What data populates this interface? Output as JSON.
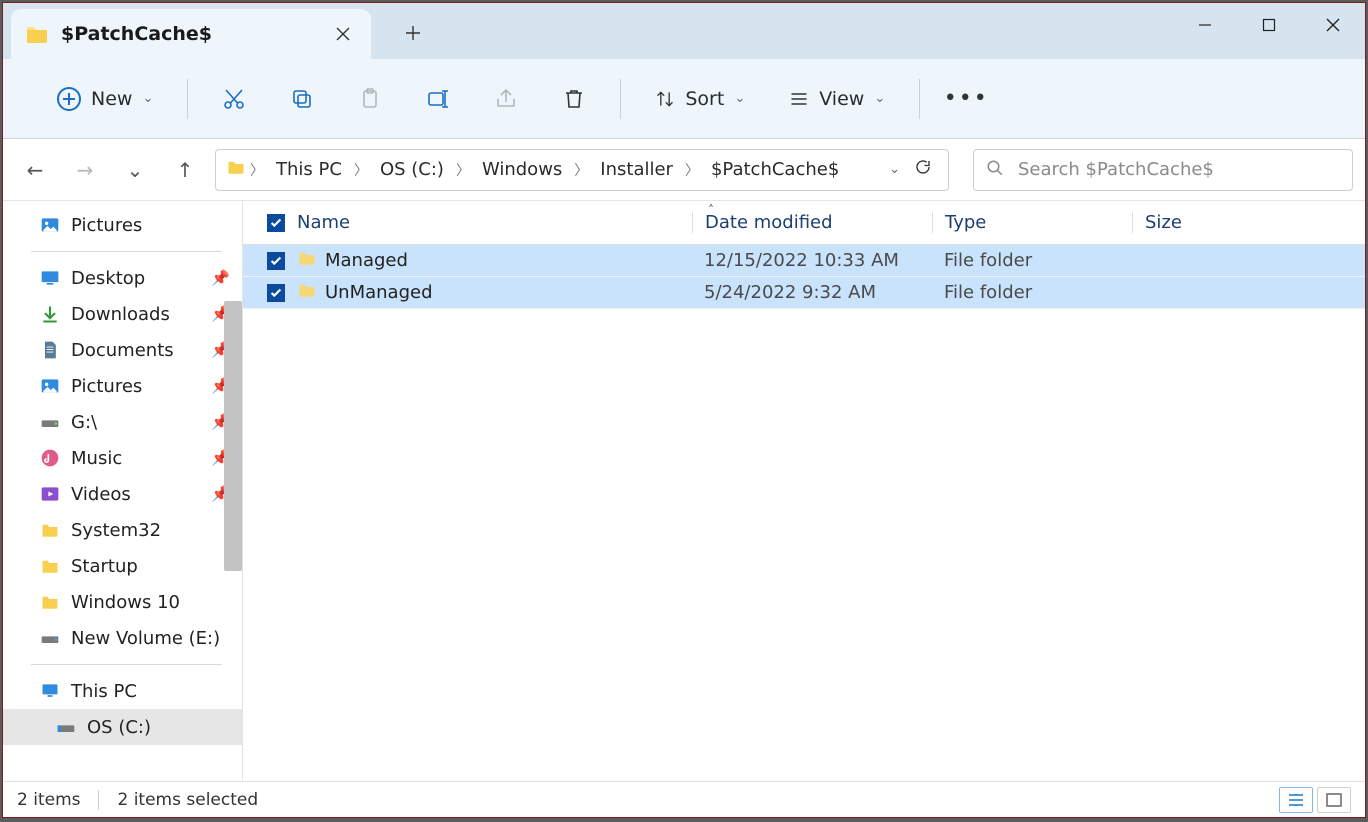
{
  "window": {
    "tab_title": "$PatchCache$"
  },
  "toolbar": {
    "new_label": "New",
    "sort_label": "Sort",
    "view_label": "View"
  },
  "breadcrumb": [
    "This PC",
    "OS (C:)",
    "Windows",
    "Installer",
    "$PatchCache$"
  ],
  "search": {
    "placeholder": "Search $PatchCache$"
  },
  "sidebar": {
    "top": {
      "label": "Pictures"
    },
    "quick": [
      {
        "label": "Desktop",
        "icon": "desktop",
        "pinned": true
      },
      {
        "label": "Downloads",
        "icon": "download",
        "pinned": true
      },
      {
        "label": "Documents",
        "icon": "document",
        "pinned": true
      },
      {
        "label": "Pictures",
        "icon": "picture",
        "pinned": true
      },
      {
        "label": "G:\\",
        "icon": "drive",
        "pinned": true
      },
      {
        "label": "Music",
        "icon": "music",
        "pinned": true
      },
      {
        "label": "Videos",
        "icon": "video",
        "pinned": true
      },
      {
        "label": "System32",
        "icon": "folder",
        "pinned": false
      },
      {
        "label": "Startup",
        "icon": "folder",
        "pinned": false
      },
      {
        "label": "Windows 10",
        "icon": "folder",
        "pinned": false
      },
      {
        "label": "New Volume (E:)",
        "icon": "drive-usb",
        "pinned": false
      }
    ],
    "thispc": {
      "label": "This PC"
    },
    "osc": {
      "label": "OS (C:)"
    }
  },
  "columns": {
    "name": "Name",
    "date": "Date modified",
    "type": "Type",
    "size": "Size"
  },
  "rows": [
    {
      "name": "Managed",
      "date": "12/15/2022 10:33 AM",
      "type": "File folder",
      "size": ""
    },
    {
      "name": "UnManaged",
      "date": "5/24/2022 9:32 AM",
      "type": "File folder",
      "size": ""
    }
  ],
  "status": {
    "count": "2 items",
    "selected": "2 items selected"
  }
}
